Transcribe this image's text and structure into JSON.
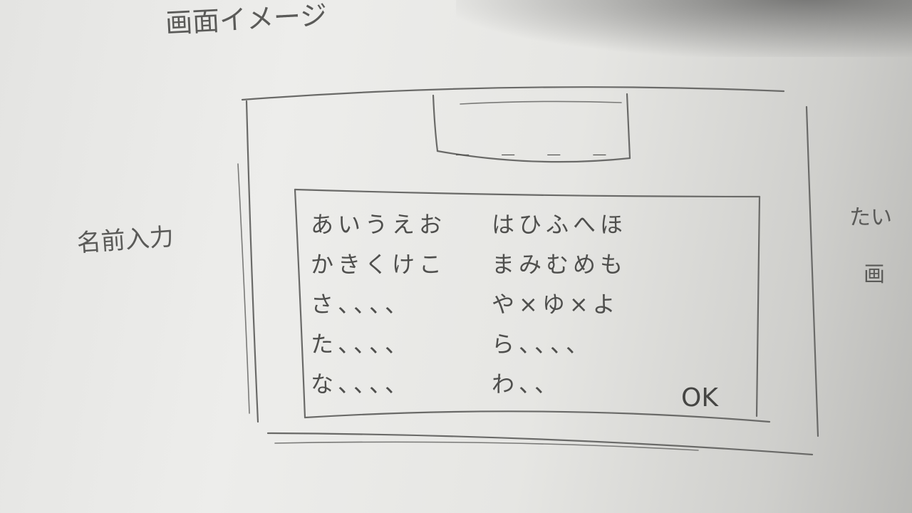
{
  "sketch": {
    "title": "画面イメージ",
    "side_note_left": "名前入力",
    "side_note_right_1": "たい",
    "side_note_right_2": "画"
  },
  "name_display": {
    "blanks": "_ _ _ _"
  },
  "keyboard": {
    "left_column": [
      "あいうえお",
      "かきくけこ",
      "さ、、、、",
      "た、、、、",
      "な、、、、"
    ],
    "right_column": [
      "はひふへほ",
      "まみむめも",
      "や×ゆ×よ",
      "ら、、、、",
      "わ、、"
    ],
    "ok_label": "OK"
  }
}
